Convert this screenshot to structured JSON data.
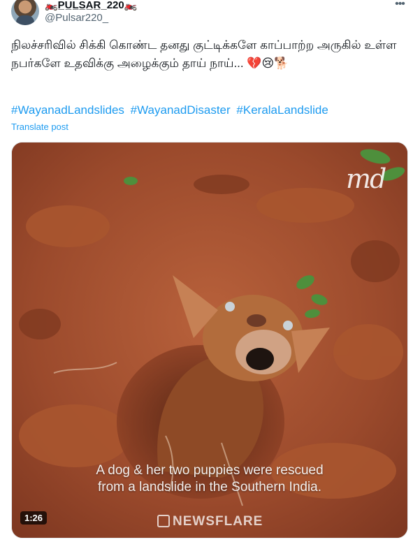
{
  "post": {
    "display_name": "🏍️P̲U̲L̲S̲A̲R̲_220🏍️",
    "handle": "@Pulsar220_",
    "text": "நிலச்சரிவில் சிக்கி கொண்ட தனது குட்டிக்களே காப்பாற்ற அருகில் உள்ள நபர்களே உதவிக்கு அழைக்கும் தாய் நாய்... 💔😢🐕",
    "hashtags": [
      "#WayanadLandslides",
      "#WayanadDisaster",
      "#KeralaLandslide"
    ],
    "translate_label": "Translate post",
    "more_icon": "more-horizontal-icon"
  },
  "video": {
    "caption_line1": "A dog & her two puppies were rescued",
    "caption_line2": "from a landslide in the Southern India.",
    "watermark": "md",
    "duration": "1:26",
    "source_brand": "NEWSFLARE"
  },
  "colors": {
    "link": "#1d9bf0",
    "secondary_text": "#536471",
    "soil": "#9b4a2c"
  }
}
